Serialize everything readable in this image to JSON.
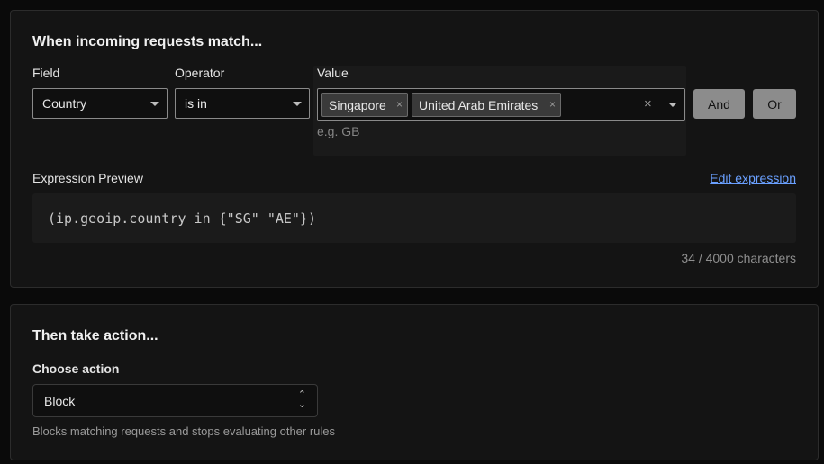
{
  "match_section": {
    "heading": "When incoming requests match...",
    "field": {
      "label": "Field",
      "value": "Country"
    },
    "operator": {
      "label": "Operator",
      "value": "is in"
    },
    "value": {
      "label": "Value",
      "chips": [
        "Singapore",
        "United Arab Emirates"
      ],
      "placeholder": "e.g. GB",
      "chip_remove_glyph": "×",
      "clear_glyph": "×"
    },
    "and_label": "And",
    "or_label": "Or",
    "preview": {
      "label": "Expression Preview",
      "edit_link": "Edit expression",
      "expression": "(ip.geoip.country in {\"SG\" \"AE\"})",
      "char_count": "34 / 4000 characters"
    }
  },
  "action_section": {
    "heading": "Then take action...",
    "choose_label": "Choose action",
    "selected": "Block",
    "description": "Blocks matching requests and stops evaluating other rules"
  },
  "colors": {
    "background": "#0a0a0a",
    "card": "#141414",
    "link": "#6aa0ff",
    "button": "#8c8c8c"
  }
}
